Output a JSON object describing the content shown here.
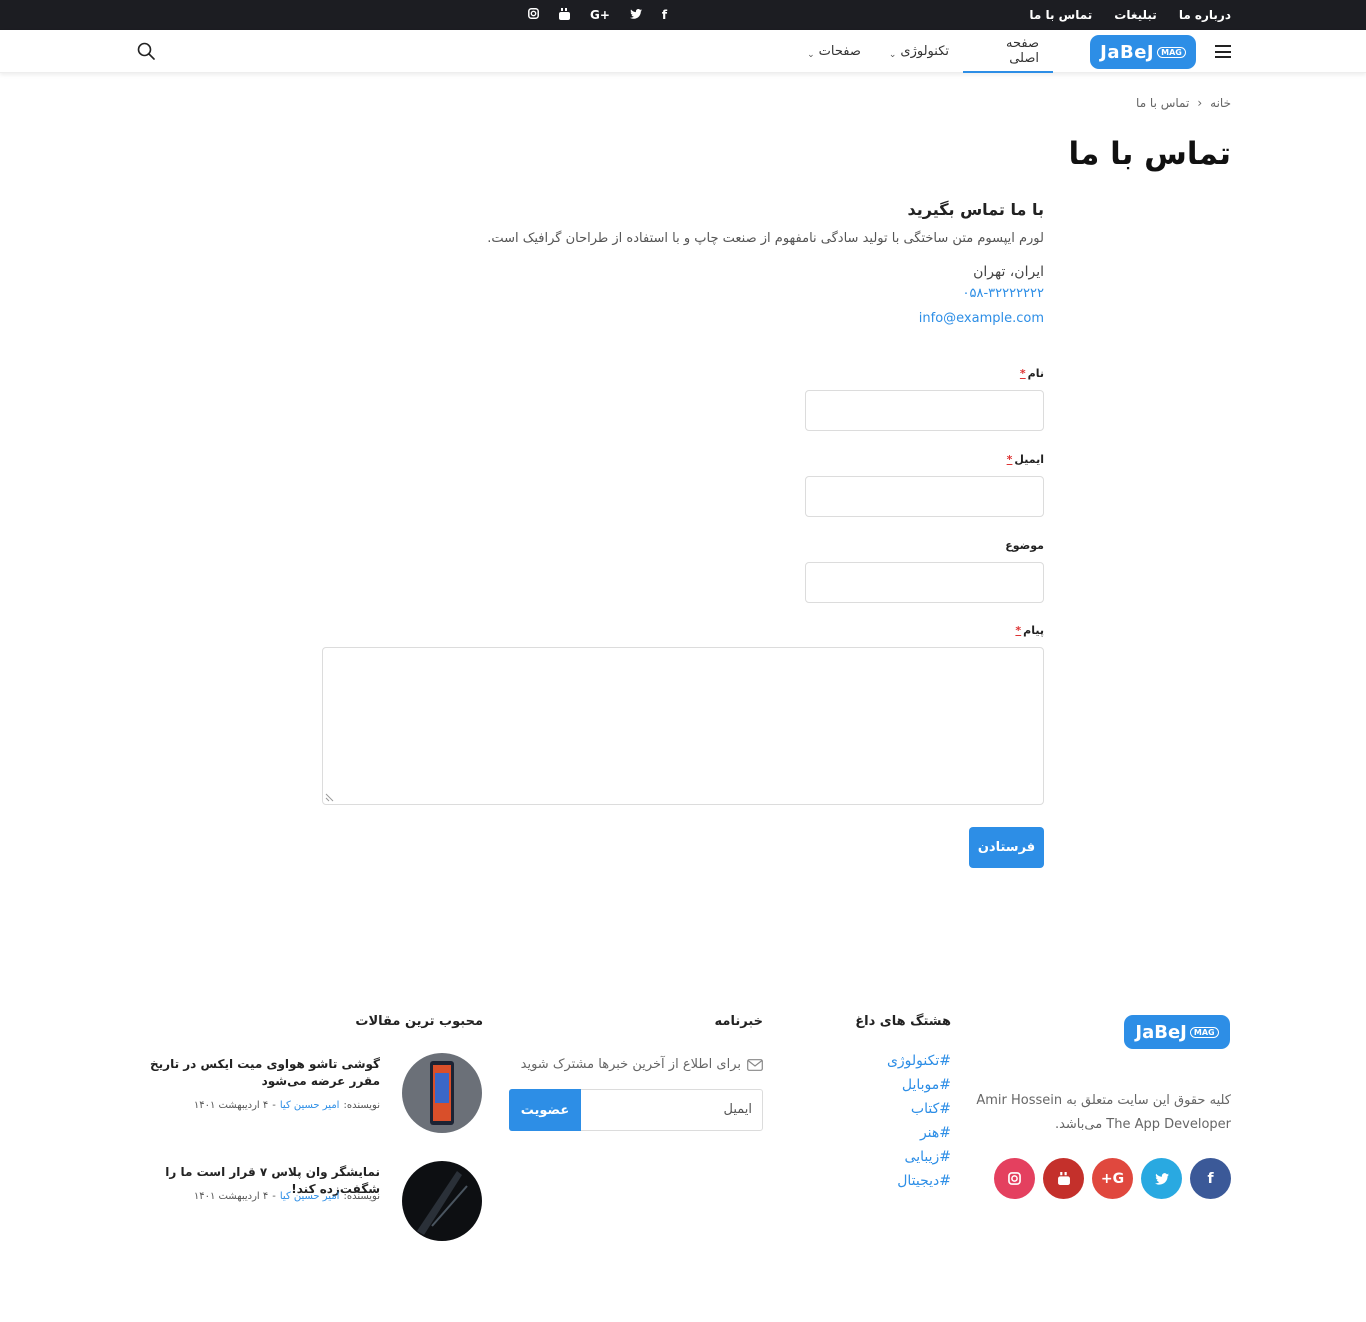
{
  "topbar": {
    "links": [
      "درباره ما",
      "تبلیغات",
      "تماس با ما"
    ],
    "social": [
      "instagram-icon",
      "youtube-icon",
      "google-plus-icon",
      "twitter-icon",
      "facebook-icon"
    ],
    "google_plus_label": "G+",
    "facebook_label": "f"
  },
  "header": {
    "logo_text": "JaBeJ",
    "logo_tag": "MAG",
    "nav": [
      {
        "label": "صفحه اصلی",
        "active": true
      },
      {
        "label": "تکنولوژی",
        "has_dropdown": true
      },
      {
        "label": "صفحات",
        "has_dropdown": true
      }
    ]
  },
  "breadcrumb": {
    "home": "خانه",
    "separator": "‹",
    "current": "تماس با ما"
  },
  "page_title": "تماس با ما",
  "contact": {
    "heading": "با ما تماس بگیرید",
    "description": "لورم ایپسوم متن ساختگی با تولید سادگی نامفهوم از صنعت چاپ و با استفاده از طراحان گرافیک است.",
    "address": "ایران، تهران",
    "phone": "۰۵۸-۳۲۲۲۲۲۲۲",
    "email": "info@example.com"
  },
  "form": {
    "name_label": "نام",
    "email_label": "ایمیل",
    "subject_label": "موضوع",
    "message_label": "پیام",
    "required_mark": "*",
    "submit_label": "فرستادن"
  },
  "footer": {
    "logo_text": "JaBeJ",
    "logo_tag": "MAG",
    "copyright": "کلیه حقوق این سایت متعلق به Amir Hossein The App Developer می‌باشد.",
    "social": [
      {
        "icon": "facebook-icon",
        "label": "f",
        "color": "#3b5998"
      },
      {
        "icon": "twitter-icon",
        "label": "t",
        "color": "#29a9e1"
      },
      {
        "icon": "google-plus-icon",
        "label": "G+",
        "color": "#e0483e"
      },
      {
        "icon": "youtube-icon",
        "label": "▶",
        "color": "#c4302b"
      },
      {
        "icon": "instagram-icon",
        "label": "◎",
        "color": "#e4405f"
      }
    ],
    "hashtags_title": "هشتگ های داغ",
    "hashtags": [
      "#تکنولوژی",
      "#موبایل",
      "#کتاب",
      "#هنر",
      "#زیبایی",
      "#دیجیتال"
    ],
    "newsletter_title": "خبرنامه",
    "newsletter_text": "برای اطلاع از آخرین خبرها مشترک شوید",
    "newsletter_placeholder": "ایمیل",
    "newsletter_button": "عضویت",
    "popular_title": "محبوب ترین مقالات",
    "popular": [
      {
        "title": "گوشی تاشو هواوی میت ایکس در تاریخ مقرر عرضه می‌شود",
        "author_label": "نویسنده:",
        "author": "امیر حسین کیا",
        "sep": "-",
        "date": "۴ اردیبهشت ۱۴۰۱"
      },
      {
        "title": "نمایشگر وان پلاس ۷ قرار است ما را شگفت‌زده کند!",
        "author_label": "نویسنده:",
        "author": "امیر حسین کیا",
        "sep": "-",
        "date": "۴ اردیبهشت ۱۴۰۱"
      }
    ]
  }
}
